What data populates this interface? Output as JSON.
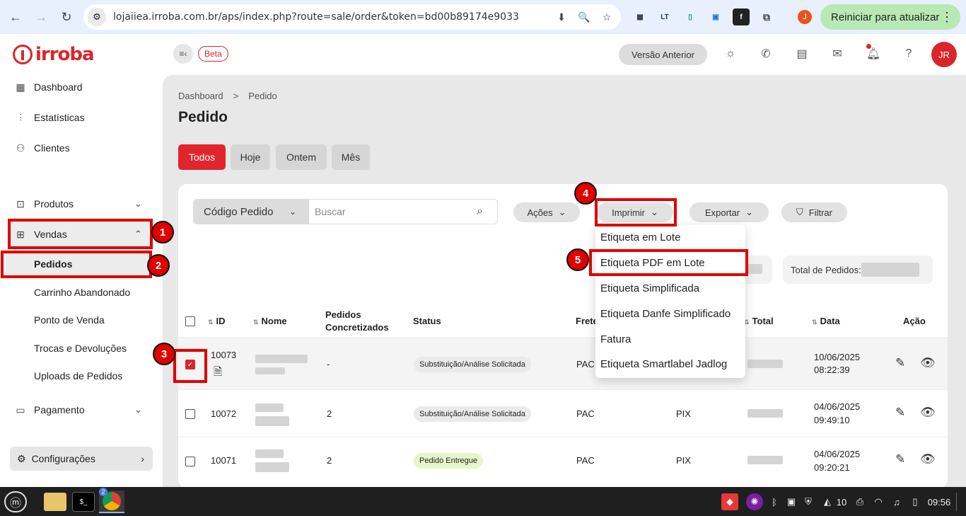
{
  "browser": {
    "url": "lojaiiea.irroba.com.br/aps/index.php?route=sale/order&token=bd00b89174e9033",
    "profile_initial": "J",
    "update_label": "Reiniciar para atualizar",
    "tab_count": "2"
  },
  "header": {
    "logo": "irroba",
    "beta": "Beta",
    "versao_anterior": "Versão Anterior",
    "user_initials": "JR"
  },
  "sidebar": {
    "dashboard": "Dashboard",
    "estatisticas": "Estatísticas",
    "clientes": "Clientes",
    "produtos": "Produtos",
    "vendas": "Vendas",
    "sub": [
      "Pedidos",
      "Carrinho Abandonado",
      "Ponto de Venda",
      "Trocas e Devoluções",
      "Uploads de Pedidos"
    ],
    "pagamento": "Pagamento",
    "configuracoes": "Configurações"
  },
  "main": {
    "breadcrumb": [
      "Dashboard",
      ">",
      "Pedido"
    ],
    "title": "Pedido",
    "tabs": [
      "Todos",
      "Hoje",
      "Ontem",
      "Mês"
    ],
    "search_select": "Código Pedido",
    "search_placeholder": "Buscar",
    "acoes": "Ações",
    "imprimir": "Imprimir",
    "exportar": "Exportar",
    "filtrar": "Filtrar",
    "total_label": "Total de Pedidos: "
  },
  "table": {
    "headers": {
      "id": "ID",
      "nome": "Nome",
      "pedidos1": "Pedidos",
      "pedidos2": "Concretizados",
      "status": "Status",
      "frete": "Frete",
      "total": "Total",
      "data": "Data",
      "acao": "Ação"
    },
    "rows": [
      {
        "id": "10073",
        "pedidos": "-",
        "status": "Substituição/Análise Solicitada",
        "frete": "PAC",
        "pagamento": "",
        "date": "10/06/2025",
        "time": "08:22:39"
      },
      {
        "id": "10072",
        "pedidos": "2",
        "status": "Substituição/Análise Solicitada",
        "frete": "PAC",
        "pagamento": "PIX",
        "date": "04/06/2025",
        "time": "09:49:10"
      },
      {
        "id": "10071",
        "pedidos": "2",
        "status": "Pedido Entregue",
        "frete": "PAC",
        "pagamento": "PIX",
        "date": "04/06/2025",
        "time": "09:20:21"
      }
    ]
  },
  "dropdown": {
    "items": [
      "Etiqueta em Lote",
      "Etiqueta PDF em Lote",
      "Etiqueta Simplificada",
      "Etiqueta Danfe Simplificado",
      "Fatura",
      "Etiqueta Smartlabel Jadlog"
    ]
  },
  "annotations": {
    "badges": [
      "1",
      "2",
      "3",
      "4",
      "5"
    ],
    "color": "#e00000"
  },
  "taskbar": {
    "volume": "10",
    "clock": "09:56"
  },
  "colors": {
    "brand": "#d9262c",
    "update_green": "#b8e8b4"
  }
}
